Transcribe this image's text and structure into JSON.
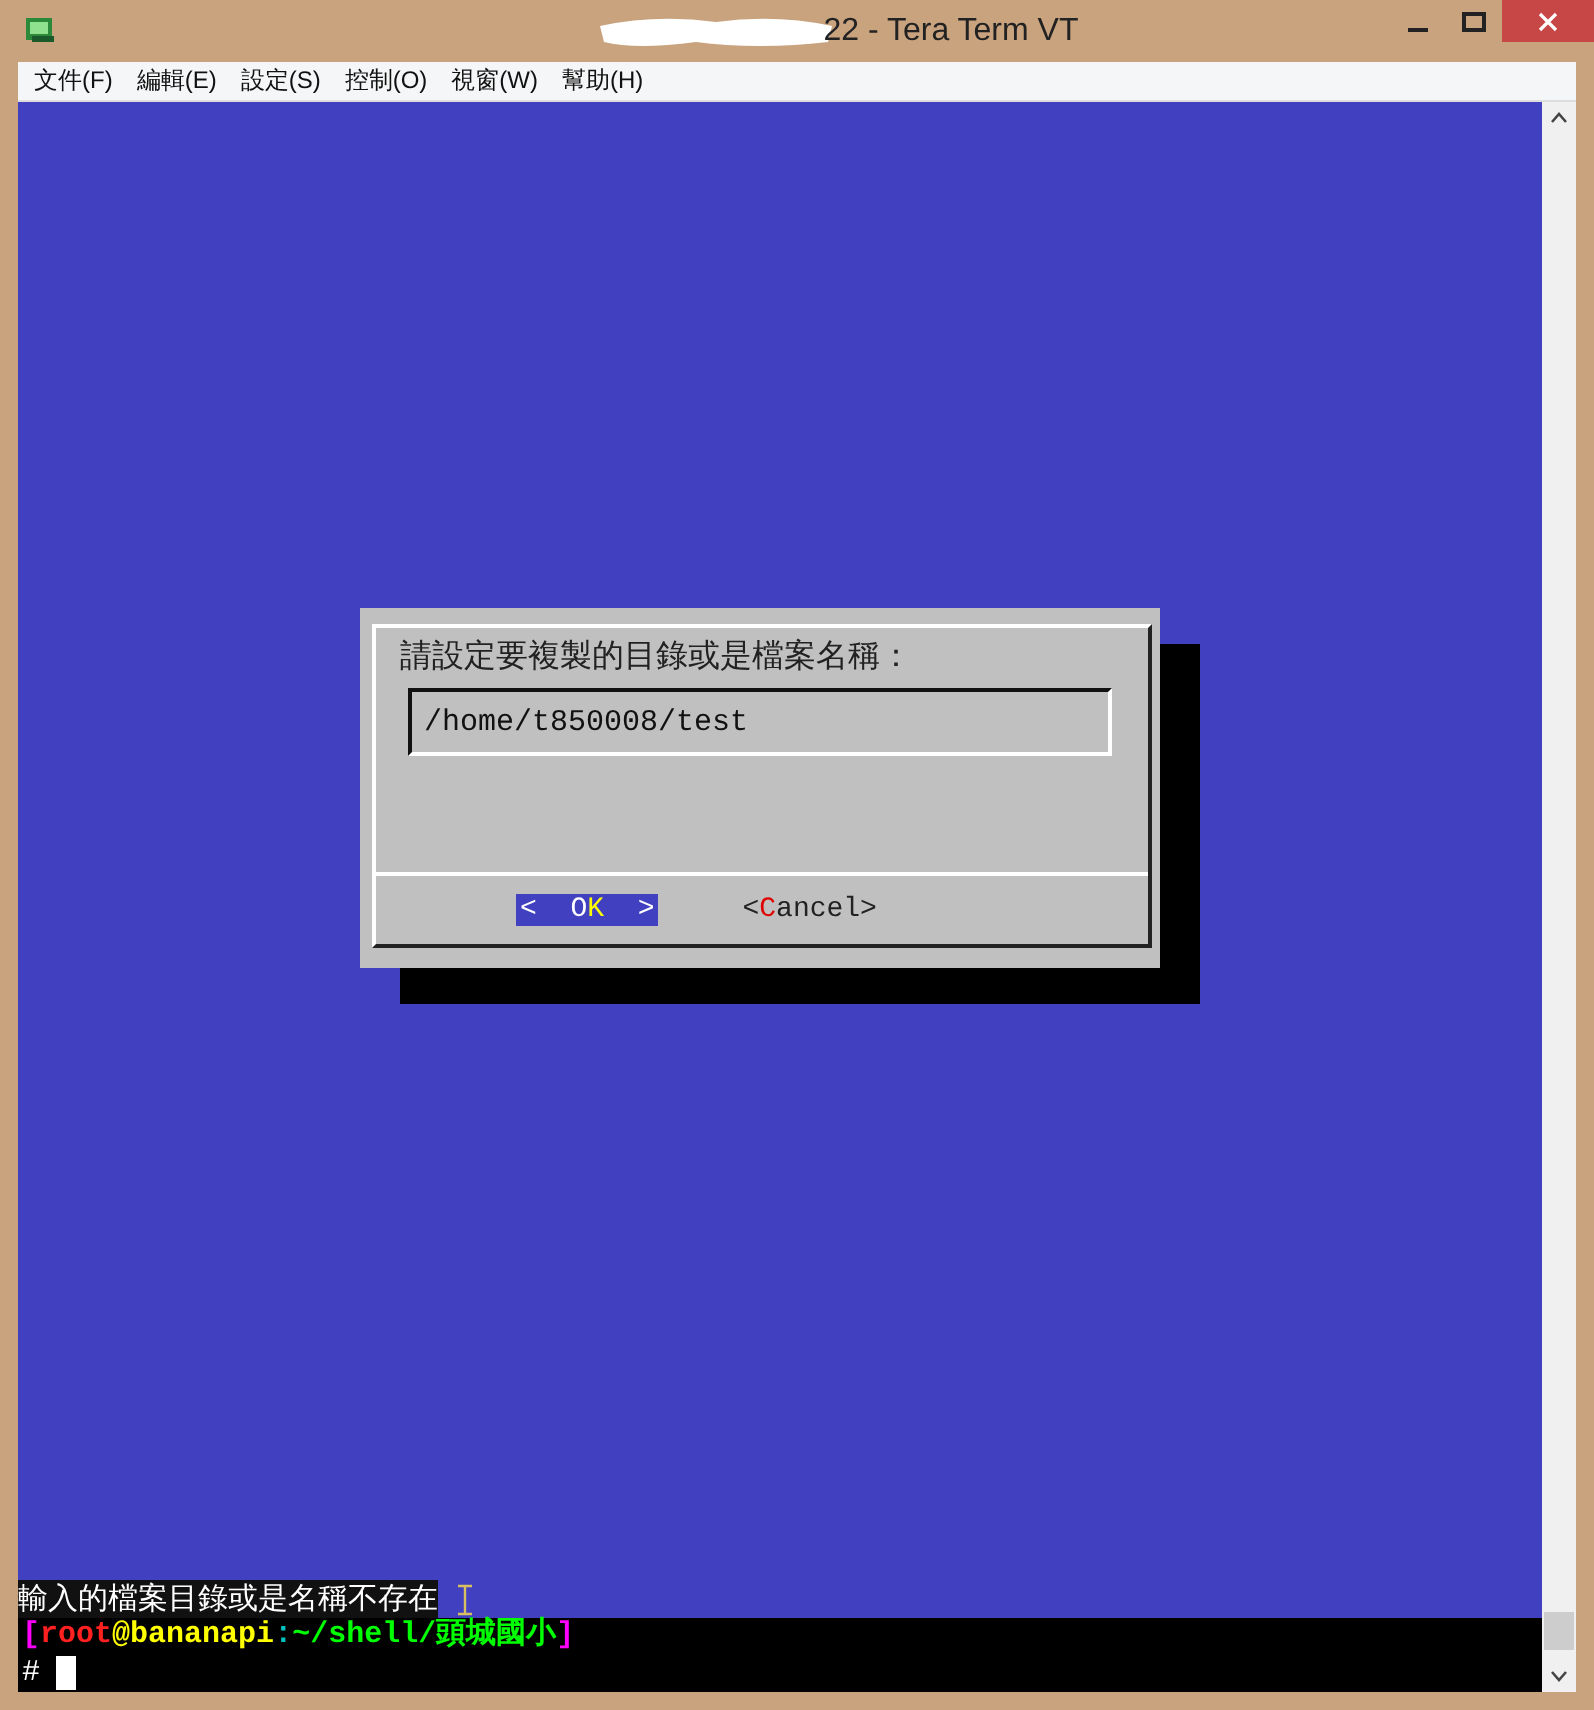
{
  "window": {
    "title": "22 - Tera Term VT"
  },
  "menu": [
    "文件(F)",
    "編輯(E)",
    "設定(S)",
    "控制(O)",
    "視窗(W)",
    "幫助(H)"
  ],
  "dialog": {
    "prompt": "請設定要複製的目錄或是檔案名稱：",
    "value": "/home/t850008/test",
    "buttons": [
      {
        "before": "<  O",
        "hotkey": "K",
        "after": "  >",
        "selected": true
      },
      {
        "before": "<",
        "hotkey": "C",
        "after": "ancel>",
        "selected": false
      }
    ]
  },
  "status_message": "輸入的檔案目錄或是名稱不存在",
  "prompt_line": [
    {
      "text": "[",
      "color": "#ff00ff"
    },
    {
      "text": "root",
      "color": "#ff2020"
    },
    {
      "text": "@",
      "color": "#ffff00"
    },
    {
      "text": "bananapi",
      "color": "#ffff00"
    },
    {
      "text": ":",
      "color": "#00c0c0"
    },
    {
      "text": "~/shell/頭城國小",
      "color": "#00ff00"
    },
    {
      "text": "]",
      "color": "#ff00ff"
    }
  ],
  "shell_prompt": "#"
}
